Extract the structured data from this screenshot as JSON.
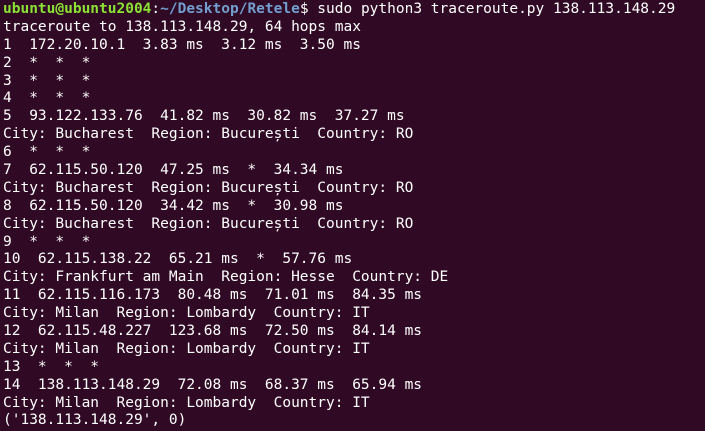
{
  "prompt": {
    "user_host": "ubuntu@ubuntu2004",
    "separator": ":",
    "path": "~/Desktop/Retele",
    "symbol": "$",
    "command": " sudo python3 traceroute.py 138.113.148.29"
  },
  "output_lines": [
    "traceroute to 138.113.148.29, 64 hops max",
    "1  172.20.10.1  3.83 ms  3.12 ms  3.50 ms",
    "2  *  *  *",
    "3  *  *  *",
    "4  *  *  *",
    "5  93.122.133.76  41.82 ms  30.82 ms  37.27 ms",
    "City: Bucharest  Region: București  Country: RO",
    "6  *  *  *",
    "7  62.115.50.120  47.25 ms  *  34.34 ms",
    "City: Bucharest  Region: București  Country: RO",
    "8  62.115.50.120  34.42 ms  *  30.98 ms",
    "City: Bucharest  Region: București  Country: RO",
    "9  *  *  *",
    "10  62.115.138.22  65.21 ms  *  57.76 ms",
    "City: Frankfurt am Main  Region: Hesse  Country: DE",
    "11  62.115.116.173  80.48 ms  71.01 ms  84.35 ms",
    "City: Milan  Region: Lombardy  Country: IT",
    "12  62.115.48.227  123.68 ms  72.50 ms  84.14 ms",
    "City: Milan  Region: Lombardy  Country: IT",
    "13  *  *  *",
    "14  138.113.148.29  72.08 ms  68.37 ms  65.94 ms",
    "City: Milan  Region: Lombardy  Country: IT",
    "('138.113.148.29', 0)"
  ],
  "colors": {
    "background": "#300a24",
    "text": "#ffffff",
    "user_host": "#8ae234",
    "path": "#729fcf"
  }
}
